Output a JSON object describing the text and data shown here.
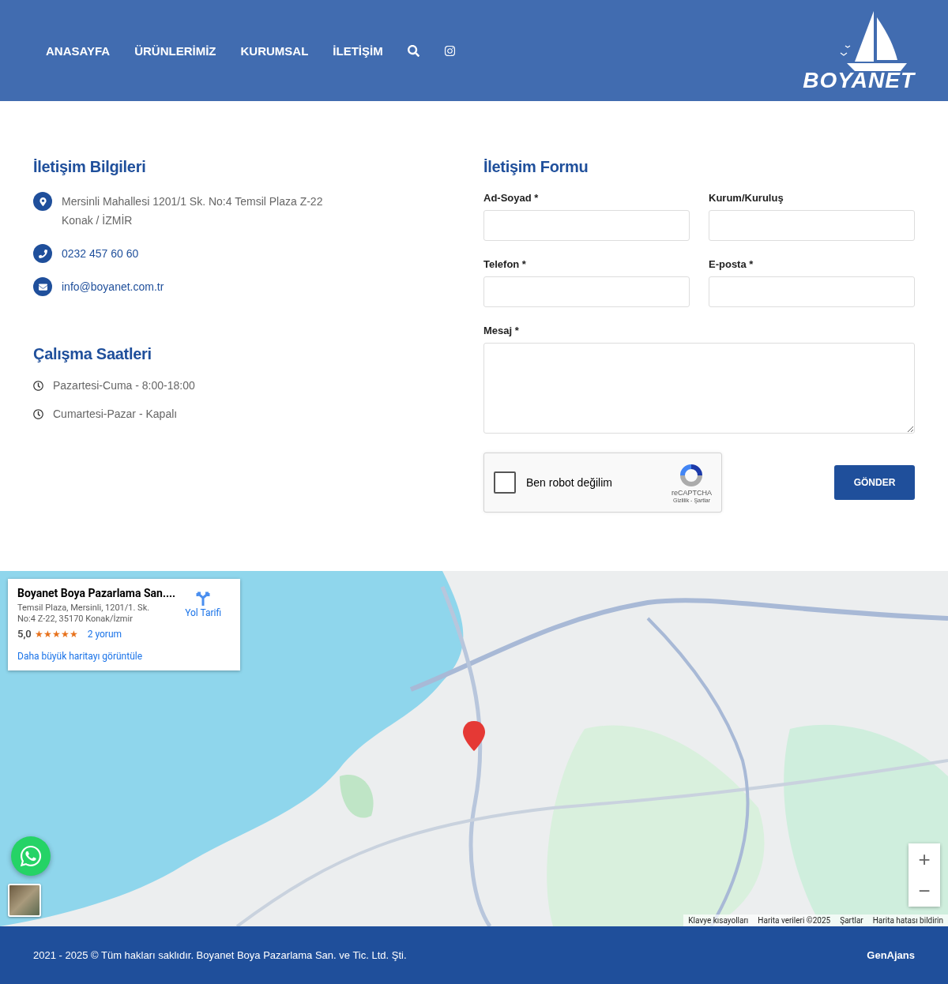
{
  "header": {
    "nav": [
      {
        "label": "ANASAYFA"
      },
      {
        "label": "ÜRÜNLERİMİZ"
      },
      {
        "label": "KURUMSAL"
      },
      {
        "label": "İLETİŞİM"
      }
    ],
    "logo": "BOYANET"
  },
  "contact_info": {
    "title": "İletişim Bilgileri",
    "items": [
      {
        "kind": "address",
        "lines": [
          "Mersinli Mahallesi 1201/1 Sk. No:4 Temsil Plaza Z-22",
          "Konak / İZMİR"
        ]
      },
      {
        "kind": "phone",
        "lines": [
          "0232 457 60 60"
        ]
      },
      {
        "kind": "email",
        "lines": [
          "info@boyanet.com.tr"
        ]
      }
    ]
  },
  "hours": {
    "title": "Çalışma Saatleri",
    "items": [
      "Pazartesi-Cuma - 8:00-18:00",
      "Cumartesi-Pazar - Kapalı"
    ]
  },
  "form": {
    "title": "İletişim Formu",
    "fields": [
      {
        "label": "Ad-Soyad *",
        "kind": "input"
      },
      {
        "label": "Kurum/Kuruluş",
        "kind": "input"
      },
      {
        "label": "Telefon *",
        "kind": "input"
      },
      {
        "label": "E-posta *",
        "kind": "input"
      },
      {
        "label": "Mesaj *",
        "kind": "textarea"
      }
    ],
    "captcha": {
      "label": "Ben robot değilim",
      "checked": false,
      "brand": "reCAPTCHA",
      "links": "Gizlilik - Şartlar"
    },
    "submit": "GÖNDER"
  },
  "map": {
    "place_card": {
      "title": "Boyanet Boya Pazarlama San....",
      "address": [
        "Temsil Plaza, Mersinli, 1201/1. Sk.",
        "No:4 Z-22, 35170 Konak/İzmir"
      ],
      "rating": "5,0",
      "stars": 5,
      "reviews": "2 yorum",
      "directions": "Yol Tarifi",
      "larger_map": "Daha büyük haritayı görüntüle"
    },
    "zoom": [
      "+",
      "−"
    ],
    "attribution": [
      "Klavye kısayolları",
      "Harita verileri ©2025",
      "Şartlar",
      "Harita hatası bildirin"
    ]
  },
  "footer": {
    "copyright": "2021 - 2025 © Tüm hakları saklıdır. Boyanet Boya Pazarlama San. ve Tic. Ltd. Şti.",
    "credit": "GenAjans"
  }
}
